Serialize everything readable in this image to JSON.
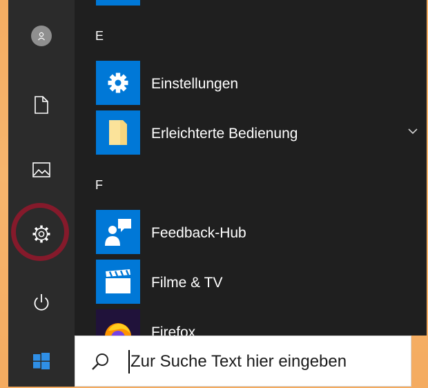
{
  "start_menu": {
    "rail": {
      "items": [
        {
          "name": "user-account",
          "icon": "user-avatar-icon"
        },
        {
          "name": "documents",
          "icon": "document-icon"
        },
        {
          "name": "pictures",
          "icon": "picture-icon"
        },
        {
          "name": "settings",
          "icon": "gear-icon",
          "highlighted": true
        },
        {
          "name": "power",
          "icon": "power-icon"
        }
      ]
    },
    "groups": [
      {
        "letter": "E",
        "apps": [
          {
            "label": "Einstellungen",
            "icon": "gear-icon",
            "tile_color": "#0078d7"
          },
          {
            "label": "Erleichterte Bedienung",
            "icon": "folder-icon",
            "tile_color": "#0078d7",
            "expandable": true
          }
        ]
      },
      {
        "letter": "F",
        "apps": [
          {
            "label": "Feedback-Hub",
            "icon": "feedback-icon",
            "tile_color": "#0078d7"
          },
          {
            "label": "Filme & TV",
            "icon": "clapperboard-icon",
            "tile_color": "#0078d7"
          },
          {
            "label": "Firefox",
            "icon": "firefox-icon",
            "tile_color": "#20123a"
          }
        ]
      }
    ]
  },
  "taskbar": {
    "start_icon": "windows-logo-icon",
    "search": {
      "placeholder": "Zur Suche Text hier eingeben",
      "icon": "search-icon"
    }
  },
  "colors": {
    "background": "#f5ad62",
    "menu": "#1f1f1f",
    "rail": "#2b2b2b",
    "accent": "#0078d7",
    "highlight_ring": "#851a2b"
  }
}
